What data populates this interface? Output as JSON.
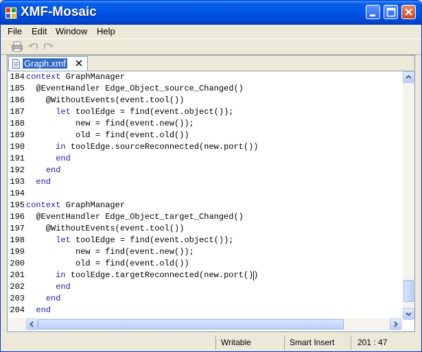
{
  "window": {
    "title": "XMF-Mosaic"
  },
  "menu": {
    "items": [
      "File",
      "Edit",
      "Window",
      "Help"
    ]
  },
  "toolbar": {
    "icons": [
      "print-icon",
      "undo-icon",
      "redo-icon"
    ]
  },
  "editor": {
    "tab_label": "Graph.xmf",
    "lines": [
      {
        "num": "184",
        "text": "context GraphManager"
      },
      {
        "num": "185",
        "text": "  @EventHandler Edge_Object_source_Changed()"
      },
      {
        "num": "186",
        "text": "    @WithoutEvents(event.tool())"
      },
      {
        "num": "187",
        "text": "      let toolEdge = find(event.object());"
      },
      {
        "num": "188",
        "text": "          new = find(event.new());"
      },
      {
        "num": "189",
        "text": "          old = find(event.old())"
      },
      {
        "num": "190",
        "text": "      in toolEdge.sourceReconnected(new.port())"
      },
      {
        "num": "191",
        "text": "      end"
      },
      {
        "num": "192",
        "text": "    end"
      },
      {
        "num": "193",
        "text": "  end"
      },
      {
        "num": "194",
        "text": ""
      },
      {
        "num": "195",
        "text": "context GraphManager"
      },
      {
        "num": "196",
        "text": "  @EventHandler Edge_Object_target_Changed()"
      },
      {
        "num": "197",
        "text": "    @WithoutEvents(event.tool())"
      },
      {
        "num": "198",
        "text": "      let toolEdge = find(event.object());"
      },
      {
        "num": "199",
        "text": "          new = find(event.new());"
      },
      {
        "num": "200",
        "text": "          old = find(event.old())"
      },
      {
        "num": "201",
        "text": "      in toolEdge.targetReconnected(new.port())"
      },
      {
        "num": "202",
        "text": "      end"
      },
      {
        "num": "203",
        "text": "    end"
      },
      {
        "num": "204",
        "text": "  end"
      }
    ]
  },
  "status": {
    "mode": "Writable",
    "insert": "Smart Insert",
    "position": "201 : 47"
  },
  "colors": {
    "title_bar": "#0055e5",
    "keyword": "#1c1c9e",
    "tab_highlight": "#316ac5"
  }
}
